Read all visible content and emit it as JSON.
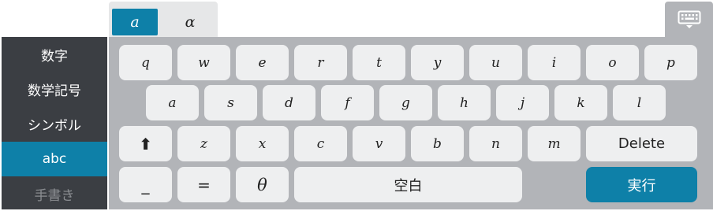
{
  "sidebar": {
    "items": [
      {
        "label": "数字"
      },
      {
        "label": "数学記号"
      },
      {
        "label": "シンボル"
      },
      {
        "label": "abc",
        "active": true
      },
      {
        "label": "手書き",
        "disabled": true
      }
    ]
  },
  "tabs": [
    {
      "label": "a",
      "active": true
    },
    {
      "label": "α",
      "active": false
    }
  ],
  "toolbar": {
    "hide_keyboard_icon": "keyboard-hide-icon"
  },
  "keyboard": {
    "row1": [
      "q",
      "w",
      "e",
      "r",
      "t",
      "y",
      "u",
      "i",
      "o",
      "p"
    ],
    "row2": [
      "a",
      "s",
      "d",
      "f",
      "g",
      "h",
      "j",
      "k",
      "l"
    ],
    "row3": {
      "shift": "⬆",
      "letters": [
        "z",
        "x",
        "c",
        "v",
        "b",
        "n",
        "m"
      ],
      "delete": "Delete"
    },
    "row4": {
      "underscore": "_",
      "equals": "=",
      "theta": "θ",
      "space": "空白",
      "execute": "実行"
    }
  },
  "colors": {
    "accent": "#0e80a8",
    "panel": "#b2b4b8",
    "key": "#eeeff0",
    "sidebar": "#3b3e43"
  }
}
